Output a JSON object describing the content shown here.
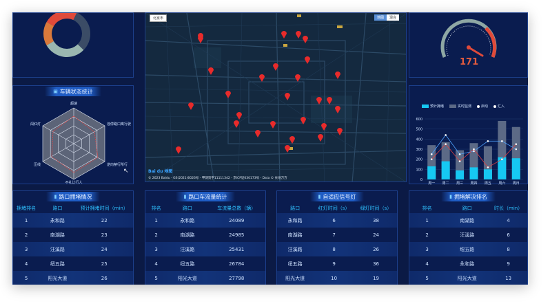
{
  "radar": {
    "title": "车辆状态统计",
    "axes": [
      "超速",
      "违停路口离行驶",
      "逆向禁行所行",
      "不礼让行人",
      "压线",
      "闯红灯"
    ]
  },
  "gauge": {
    "value": "171"
  },
  "map": {
    "label_tl": "北京市",
    "btn_map": "地图",
    "btn_sat": "混合",
    "footer": "© 2023 Baidu - GS(2021)6026号 - 甲测资字11111342 - 京ICP证030173号 - Data © 长地万方",
    "logo": "Bai du 地图"
  },
  "chart_data": {
    "type": "bar",
    "categories": [
      "周一",
      "周二",
      "周三",
      "周四",
      "周五",
      "周六",
      "周日"
    ],
    "series": [
      {
        "name": "预计拥堵",
        "type": "bar",
        "values": [
          130,
          180,
          90,
          120,
          100,
          220,
          210
        ]
      },
      {
        "name": "实时监测",
        "type": "bar",
        "values": [
          340,
          370,
          290,
          360,
          330,
          580,
          520
        ]
      },
      {
        "name": "启动",
        "type": "line",
        "values": [
          250,
          440,
          250,
          280,
          380,
          380,
          300
        ]
      },
      {
        "name": "汇入",
        "type": "line",
        "values": [
          200,
          350,
          180,
          300,
          120,
          200,
          350
        ]
      }
    ],
    "yticks": [
      "600",
      "500",
      "400",
      "300",
      "200",
      "100",
      "0"
    ],
    "ylim": [
      0,
      600
    ],
    "colors": {
      "bar1": "#16c8f2",
      "bar2": "#5c6a86",
      "line1": "#4fa3ff",
      "line2": "#e04040"
    }
  },
  "tables": [
    {
      "title": "路口拥堵情况",
      "headers": [
        "拥堵排名",
        "路口",
        "预计拥堵时间（min）"
      ],
      "rows": [
        [
          "1",
          "永和路",
          "22"
        ],
        [
          "2",
          "南湖路",
          "23"
        ],
        [
          "3",
          "汪溪路",
          "24"
        ],
        [
          "4",
          "纽五路",
          "25"
        ],
        [
          "5",
          "阳光大道",
          "26"
        ]
      ]
    },
    {
      "title": "路口车流量统计",
      "headers": [
        "排名",
        "路口",
        "车流量总数（辆）"
      ],
      "rows": [
        [
          "1",
          "永和路",
          "24089"
        ],
        [
          "2",
          "南湖路",
          "24985"
        ],
        [
          "3",
          "汪溪路",
          "25431"
        ],
        [
          "4",
          "纽五路",
          "26784"
        ],
        [
          "5",
          "阳光大道",
          "27798"
        ]
      ]
    },
    {
      "title": "自适应信号灯",
      "headers": [
        "路口",
        "红灯时间（s）",
        "绿灯时间（s）"
      ],
      "rows": [
        [
          "永和路",
          "6",
          "38"
        ],
        [
          "南湖路",
          "7",
          "24"
        ],
        [
          "汪溪路",
          "8",
          "26"
        ],
        [
          "纽五路",
          "9",
          "36"
        ],
        [
          "阳光大道",
          "10",
          "19"
        ]
      ]
    },
    {
      "title": "拥堵解决排名",
      "headers": [
        "排名",
        "路口",
        "时长（min）"
      ],
      "rows": [
        [
          "1",
          "南湖路",
          "4"
        ],
        [
          "2",
          "汪溪路",
          "6"
        ],
        [
          "3",
          "纽五路",
          "8"
        ],
        [
          "4",
          "永和路",
          "9"
        ],
        [
          "5",
          "阳光大道",
          "13"
        ]
      ]
    }
  ]
}
